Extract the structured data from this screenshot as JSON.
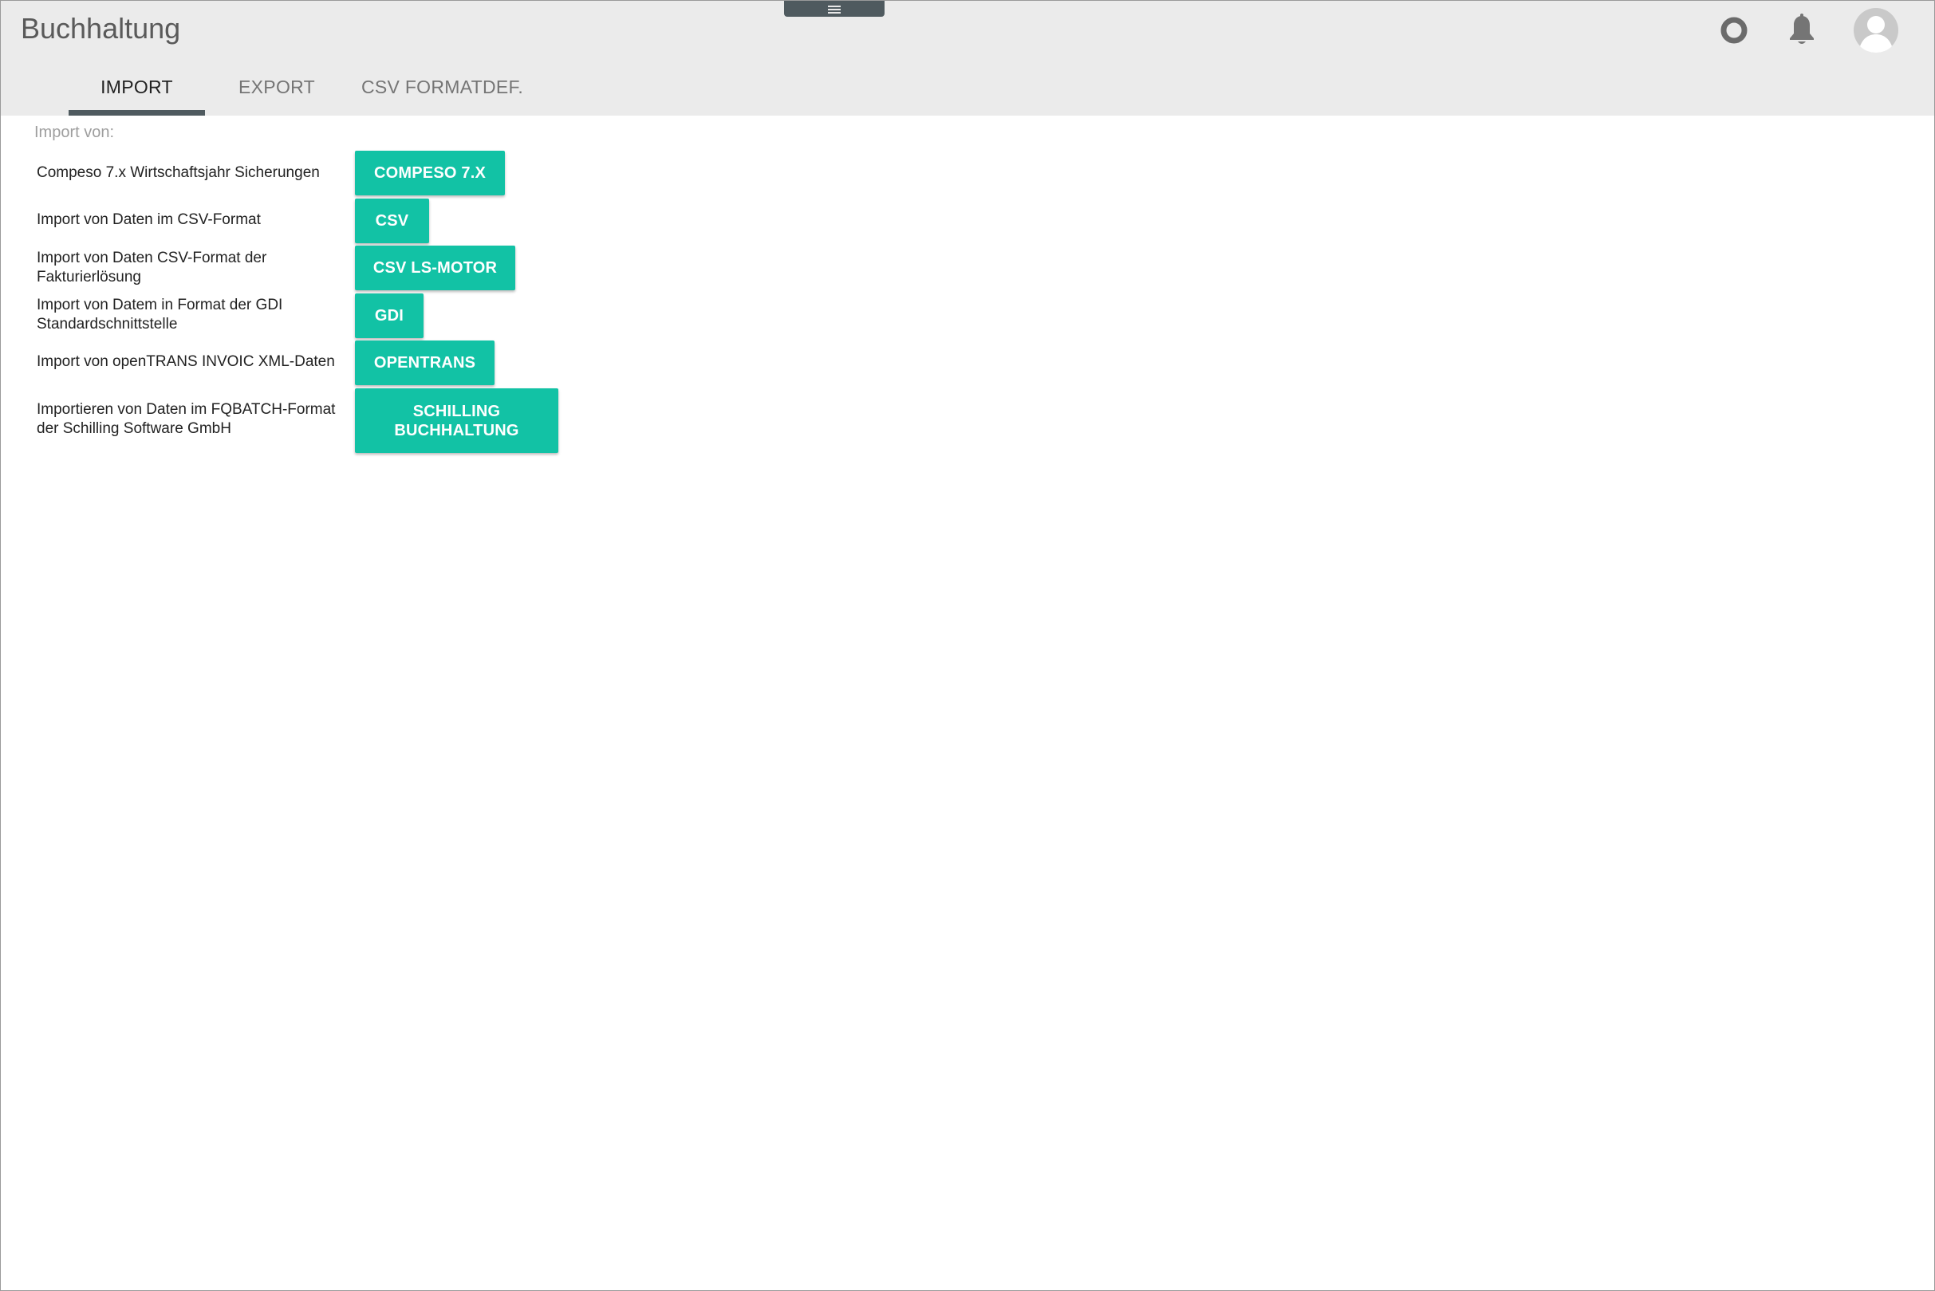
{
  "app": {
    "title": "Buchhaltung"
  },
  "header": {
    "icons": [
      "status-circle-icon",
      "bell-icon",
      "user-avatar-icon"
    ]
  },
  "tabs": [
    {
      "label": "IMPORT",
      "active": true
    },
    {
      "label": "EXPORT",
      "active": false
    },
    {
      "label": "CSV FORMATDEF.",
      "active": false
    }
  ],
  "import": {
    "section_label": "Import von:",
    "rows": [
      {
        "description": "Compeso 7.x Wirtschaftsjahr Sicherungen",
        "button": "COMPESO 7.X"
      },
      {
        "description": "Import von Daten im CSV-Format",
        "button": "CSV"
      },
      {
        "description": "Import von Daten CSV-Format der Fakturierlösung",
        "button": "CSV LS-MOTOR"
      },
      {
        "description": "Import von Datem in Format der GDI Standardschnittstelle",
        "button": "GDI"
      },
      {
        "description": "Import von openTRANS INVOIC XML-Daten",
        "button": "OPENTRANS"
      },
      {
        "description": "Importieren von Daten im FQBATCH-Format der Schilling Software GmbH",
        "button": "SCHILLING BUCHHALTUNG"
      }
    ]
  },
  "colors": {
    "accent_button": "#12c2a5",
    "header_bg": "#ebebeb",
    "tab_indicator": "#4f5a5f"
  }
}
